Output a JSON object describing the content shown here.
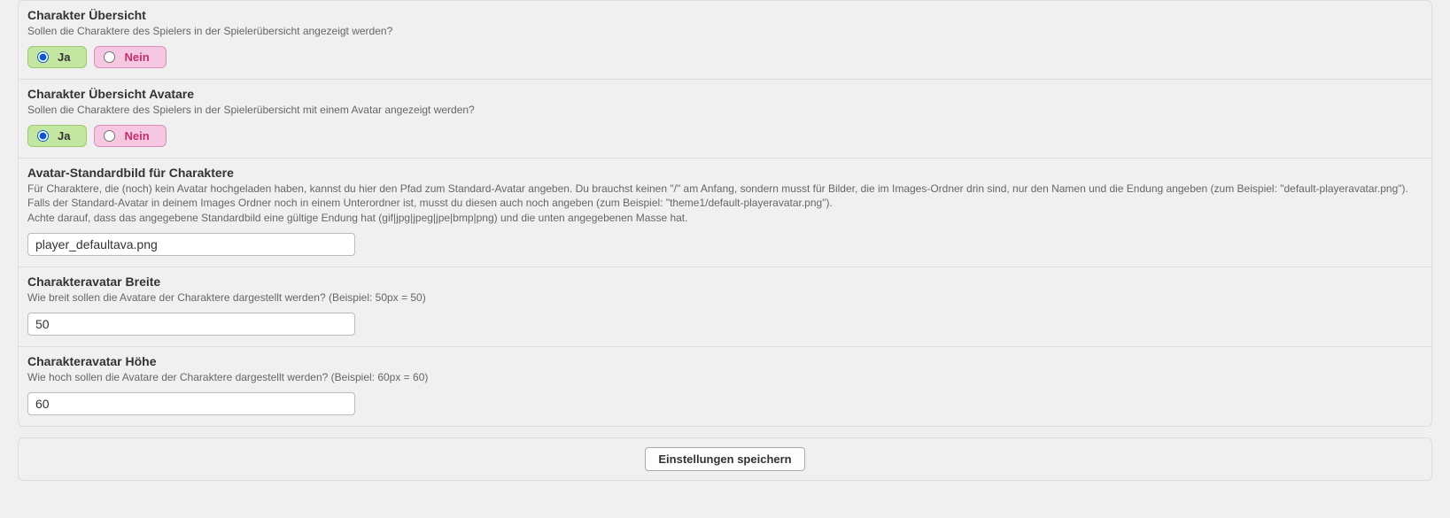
{
  "sections": {
    "charOverview": {
      "title": "Charakter Übersicht",
      "desc": "Sollen die Charaktere des Spielers in der Spielerübersicht angezeigt werden?",
      "yes": "Ja",
      "no": "Nein",
      "value": "yes"
    },
    "charOverviewAvatars": {
      "title": "Charakter Übersicht Avatare",
      "desc": "Sollen die Charaktere des Spielers in der Spielerübersicht mit einem Avatar angezeigt werden?",
      "yes": "Ja",
      "no": "Nein",
      "value": "yes"
    },
    "defaultAvatar": {
      "title": "Avatar-Standardbild für Charaktere",
      "desc1": "Für Charaktere, die (noch) kein Avatar hochgeladen haben, kannst du hier den Pfad zum Standard-Avatar angeben. Du brauchst keinen \"/\" am Anfang, sondern musst für Bilder, die im Images-Ordner drin sind, nur den Namen und die Endung angeben (zum Beispiel: \"default-playeravatar.png\"). Falls der Standard-Avatar in deinem Images Ordner noch in einem Unterordner ist, musst du diesen auch noch angeben (zum Beispiel: \"theme1/default-playeravatar.png\").",
      "desc2": "Achte darauf, dass das angegebene Standardbild eine gültige Endung hat (gif|jpg|jpeg|jpe|bmp|png) und die unten angegebenen Masse hat.",
      "value": "player_defaultava.png"
    },
    "avatarWidth": {
      "title": "Charakteravatar Breite",
      "desc": "Wie breit sollen die Avatare der Charaktere dargestellt werden? (Beispiel: 50px = 50)",
      "value": "50"
    },
    "avatarHeight": {
      "title": "Charakteravatar Höhe",
      "desc": "Wie hoch sollen die Avatare der Charaktere dargestellt werden? (Beispiel: 60px = 60)",
      "value": "60"
    }
  },
  "saveButton": "Einstellungen speichern"
}
